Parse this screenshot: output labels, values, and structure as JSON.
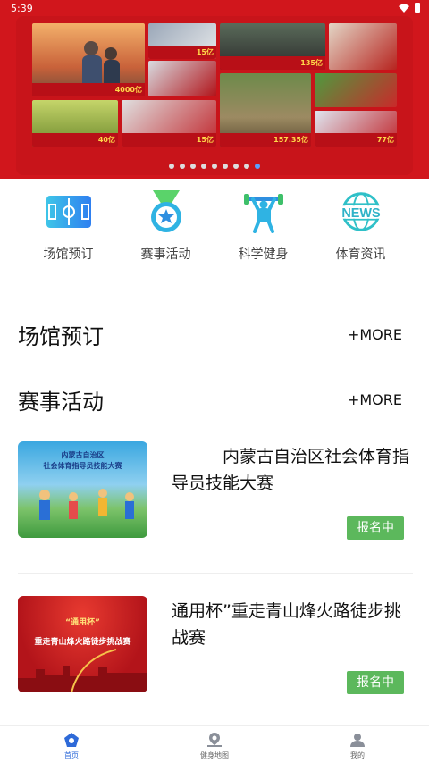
{
  "status_bar": {
    "time": "5:39"
  },
  "banner": {
    "captions": [
      "4000亿",
      "15亿",
      "135亿",
      "40亿",
      "15亿",
      "157.35亿",
      "77亿"
    ],
    "dot_count": 9,
    "active_dot": 8
  },
  "quick_menu": [
    {
      "label": "场馆预订",
      "icon": "stadium-icon"
    },
    {
      "label": "赛事活动",
      "icon": "medal-icon"
    },
    {
      "label": "科学健身",
      "icon": "fitness-icon"
    },
    {
      "label": "体育资讯",
      "icon": "news-icon"
    }
  ],
  "news_icon_text": "NEWS",
  "sections": {
    "venue": {
      "title": "场馆预订",
      "more": "+MORE"
    },
    "events": {
      "title": "赛事活动",
      "more": "+MORE"
    }
  },
  "events": [
    {
      "title": "　　　内蒙古自治区社会体育指导员技能大赛",
      "badge": "报名中",
      "thumb_text": "内蒙古自治区\n社会体育指导员技能大赛"
    },
    {
      "title": "通用杯”重走青山烽火路徒步挑战赛",
      "badge": "报名中",
      "thumb_text": "“通用杯”",
      "thumb_sub": "重走青山烽火路徒步挑战赛"
    }
  ],
  "bottom_nav": [
    {
      "label": "首页",
      "active": true
    },
    {
      "label": "健身地图",
      "active": false
    },
    {
      "label": "我的",
      "active": false
    }
  ],
  "colors": {
    "brand_red": "#d1161c",
    "badge_green": "#5cb85c",
    "accent_blue": "#2e6ad8"
  }
}
